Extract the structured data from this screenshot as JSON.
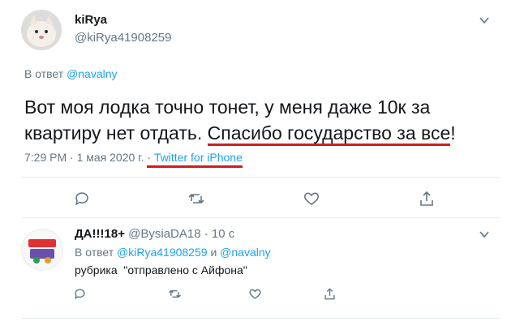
{
  "tweet": {
    "display_name": "kiRya",
    "handle": "@kiRya41908259",
    "reply_prefix": "В ответ",
    "reply_mention": "@navalny",
    "text_part1": "Вот моя лодка точно тонет, у меня даже 10к за квартиру нет отдать. ",
    "text_part2": "Спасибо государство за все",
    "text_part3": "!",
    "timestamp": "7:29 PM · 1 мая 2020 г.",
    "source_separator": "·",
    "source": "Twitter for iPhone"
  },
  "reply": {
    "display_name": "ДА!!!18+",
    "handle": "@BysiaDA18",
    "time_ago": "· 10 с",
    "reply_prefix": "В ответ",
    "mention1": "@kiRya41908259",
    "and_word": "и",
    "mention2": "@navalny",
    "text": "рубрика  \"отправлено с Айфона\""
  },
  "colors": {
    "accent": "#1da1f2",
    "muted": "#657786",
    "highlight_underline": "#cc1f1f"
  },
  "icons": [
    "user-avatar-icon",
    "chevron-down-icon",
    "comment-icon",
    "retweet-icon",
    "like-icon",
    "share-icon"
  ]
}
